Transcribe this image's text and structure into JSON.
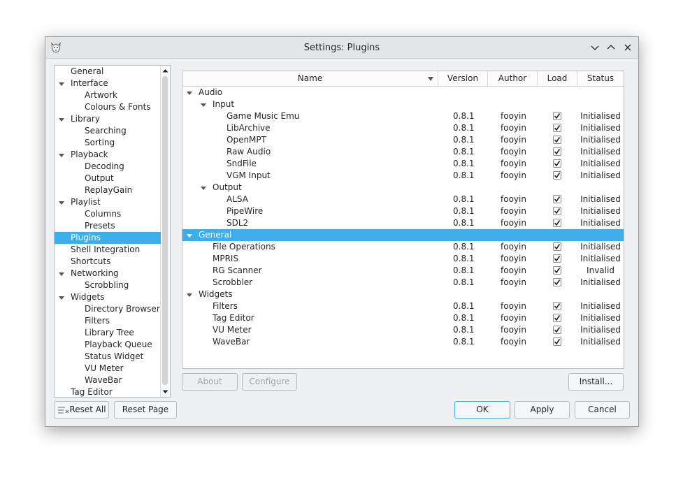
{
  "window": {
    "title": "Settings: Plugins"
  },
  "nav": {
    "items": [
      {
        "label": "General",
        "depth": 0,
        "expander": false
      },
      {
        "label": "Interface",
        "depth": 0,
        "expander": true
      },
      {
        "label": "Artwork",
        "depth": 1,
        "expander": false
      },
      {
        "label": "Colours & Fonts",
        "depth": 1,
        "expander": false
      },
      {
        "label": "Library",
        "depth": 0,
        "expander": true
      },
      {
        "label": "Searching",
        "depth": 1,
        "expander": false
      },
      {
        "label": "Sorting",
        "depth": 1,
        "expander": false
      },
      {
        "label": "Playback",
        "depth": 0,
        "expander": true
      },
      {
        "label": "Decoding",
        "depth": 1,
        "expander": false
      },
      {
        "label": "Output",
        "depth": 1,
        "expander": false
      },
      {
        "label": "ReplayGain",
        "depth": 1,
        "expander": false
      },
      {
        "label": "Playlist",
        "depth": 0,
        "expander": true
      },
      {
        "label": "Columns",
        "depth": 1,
        "expander": false
      },
      {
        "label": "Presets",
        "depth": 1,
        "expander": false
      },
      {
        "label": "Plugins",
        "depth": 0,
        "expander": false,
        "selected": true
      },
      {
        "label": "Shell Integration",
        "depth": 0,
        "expander": false
      },
      {
        "label": "Shortcuts",
        "depth": 0,
        "expander": false
      },
      {
        "label": "Networking",
        "depth": 0,
        "expander": true
      },
      {
        "label": "Scrobbling",
        "depth": 1,
        "expander": false
      },
      {
        "label": "Widgets",
        "depth": 0,
        "expander": true
      },
      {
        "label": "Directory Browser",
        "depth": 1,
        "expander": false
      },
      {
        "label": "Filters",
        "depth": 1,
        "expander": false
      },
      {
        "label": "Library Tree",
        "depth": 1,
        "expander": false
      },
      {
        "label": "Playback Queue",
        "depth": 1,
        "expander": false
      },
      {
        "label": "Status Widget",
        "depth": 1,
        "expander": false
      },
      {
        "label": "VU Meter",
        "depth": 1,
        "expander": false
      },
      {
        "label": "WaveBar",
        "depth": 1,
        "expander": false
      },
      {
        "label": "Tag Editor",
        "depth": 0,
        "expander": false
      }
    ]
  },
  "plugins": {
    "columns": [
      "Name",
      "Version",
      "Author",
      "Load",
      "Status"
    ],
    "rows": [
      {
        "type": "group",
        "depth": 0,
        "name": "Audio"
      },
      {
        "type": "group",
        "depth": 1,
        "name": "Input"
      },
      {
        "type": "plugin",
        "depth": 2,
        "name": "Game Music Emu",
        "version": "0.8.1",
        "author": "fooyin",
        "load": true,
        "status": "Initialised"
      },
      {
        "type": "plugin",
        "depth": 2,
        "name": "LibArchive",
        "version": "0.8.1",
        "author": "fooyin",
        "load": true,
        "status": "Initialised"
      },
      {
        "type": "plugin",
        "depth": 2,
        "name": "OpenMPT",
        "version": "0.8.1",
        "author": "fooyin",
        "load": true,
        "status": "Initialised"
      },
      {
        "type": "plugin",
        "depth": 2,
        "name": "Raw Audio",
        "version": "0.8.1",
        "author": "fooyin",
        "load": true,
        "status": "Initialised"
      },
      {
        "type": "plugin",
        "depth": 2,
        "name": "SndFile",
        "version": "0.8.1",
        "author": "fooyin",
        "load": true,
        "status": "Initialised"
      },
      {
        "type": "plugin",
        "depth": 2,
        "name": "VGM Input",
        "version": "0.8.1",
        "author": "fooyin",
        "load": true,
        "status": "Initialised"
      },
      {
        "type": "group",
        "depth": 1,
        "name": "Output"
      },
      {
        "type": "plugin",
        "depth": 2,
        "name": "ALSA",
        "version": "0.8.1",
        "author": "fooyin",
        "load": true,
        "status": "Initialised"
      },
      {
        "type": "plugin",
        "depth": 2,
        "name": "PipeWire",
        "version": "0.8.1",
        "author": "fooyin",
        "load": true,
        "status": "Initialised"
      },
      {
        "type": "plugin",
        "depth": 2,
        "name": "SDL2",
        "version": "0.8.1",
        "author": "fooyin",
        "load": true,
        "status": "Initialised"
      },
      {
        "type": "group",
        "depth": 0,
        "name": "General",
        "selected": true
      },
      {
        "type": "plugin",
        "depth": 1,
        "name": "File Operations",
        "version": "0.8.1",
        "author": "fooyin",
        "load": true,
        "status": "Initialised"
      },
      {
        "type": "plugin",
        "depth": 1,
        "name": "MPRIS",
        "version": "0.8.1",
        "author": "fooyin",
        "load": true,
        "status": "Initialised"
      },
      {
        "type": "plugin",
        "depth": 1,
        "name": "RG Scanner",
        "version": "0.8.1",
        "author": "fooyin",
        "load": true,
        "status": "Invalid"
      },
      {
        "type": "plugin",
        "depth": 1,
        "name": "Scrobbler",
        "version": "0.8.1",
        "author": "fooyin",
        "load": true,
        "status": "Initialised"
      },
      {
        "type": "group",
        "depth": 0,
        "name": "Widgets"
      },
      {
        "type": "plugin",
        "depth": 1,
        "name": "Filters",
        "version": "0.8.1",
        "author": "fooyin",
        "load": true,
        "status": "Initialised"
      },
      {
        "type": "plugin",
        "depth": 1,
        "name": "Tag Editor",
        "version": "0.8.1",
        "author": "fooyin",
        "load": true,
        "status": "Initialised"
      },
      {
        "type": "plugin",
        "depth": 1,
        "name": "VU Meter",
        "version": "0.8.1",
        "author": "fooyin",
        "load": true,
        "status": "Initialised"
      },
      {
        "type": "plugin",
        "depth": 1,
        "name": "WaveBar",
        "version": "0.8.1",
        "author": "fooyin",
        "load": true,
        "status": "Initialised"
      }
    ]
  },
  "buttons": {
    "about": "About",
    "configure": "Configure",
    "install": "Install...",
    "reset_all": "Reset All",
    "reset_page": "Reset Page",
    "ok": "OK",
    "apply": "Apply",
    "cancel": "Cancel"
  },
  "colors": {
    "accent": "#3daee9",
    "window_bg": "#eff0f1"
  }
}
